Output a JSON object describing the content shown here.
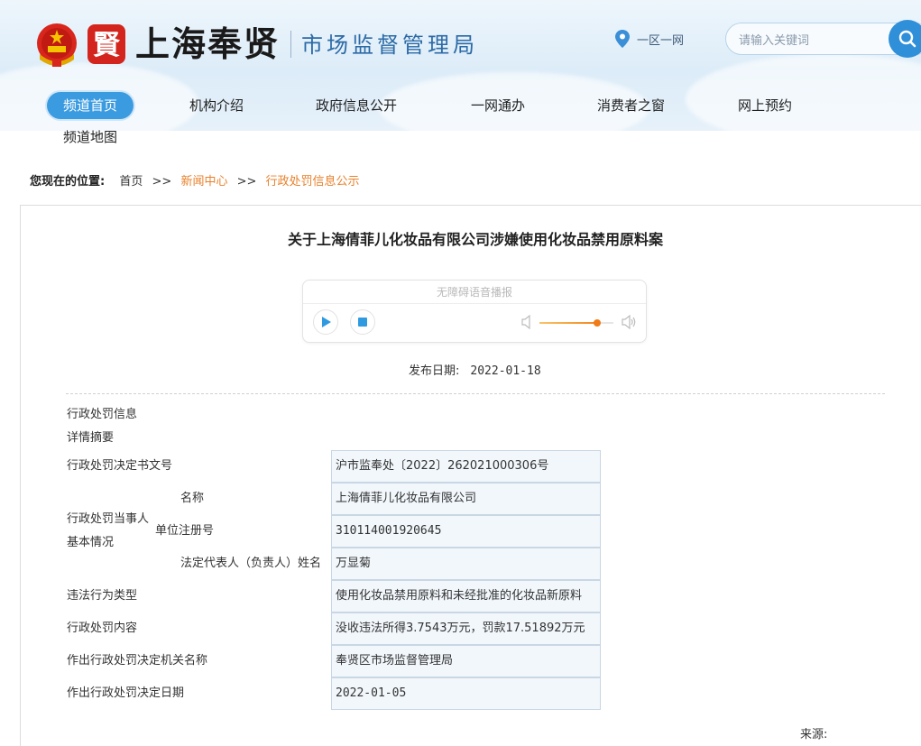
{
  "header": {
    "brand_name": "上海奉贤",
    "brand_sub": "市场监督管理局",
    "seal_text": "賢",
    "location_label": "一区一网",
    "search_placeholder": "请输入关键词"
  },
  "nav": {
    "items": [
      {
        "label": "频道首页",
        "active": true
      },
      {
        "label": "机构介绍"
      },
      {
        "label": "政府信息公开"
      },
      {
        "label": "一网通办"
      },
      {
        "label": "消费者之窗"
      },
      {
        "label": "网上预约"
      },
      {
        "label": "频道地图"
      }
    ]
  },
  "breadcrumb": {
    "lead": "您现在的位置:",
    "items": [
      "首页",
      "新闻中心",
      "行政处罚信息公示"
    ],
    "separator": ">>"
  },
  "article": {
    "title": "关于上海倩菲儿化妆品有限公司涉嫌使用化妆品禁用原料案",
    "player": {
      "label": "无障碍语音播报",
      "volume": 0.78
    },
    "publish_label": "发布日期:",
    "publish_date": "2022-01-18",
    "source_label": "来源:"
  },
  "info": {
    "section_heading": "行政处罚信息",
    "section_sub": "详情摘要",
    "rows": {
      "doc_no_label": "行政处罚决定书文号",
      "doc_no_value": "沪市监奉处〔2022〕262021000306号",
      "party_label_1": "行政处罚当事人",
      "party_label_2": "基本情况",
      "name_label": "名称",
      "name_value": "上海倩菲儿化妆品有限公司",
      "reg_label": "单位注册号",
      "reg_value": "310114001920645",
      "rep_label": "法定代表人（负责人）姓名",
      "rep_value": "万显菊",
      "violation_label": "违法行为类型",
      "violation_value": "使用化妆品禁用原料和未经批准的化妆品新原料",
      "content_label": "行政处罚内容",
      "content_value": "没收违法所得3.7543万元，罚款17.51892万元",
      "authority_label": "作出行政处罚决定机关名称",
      "authority_value": "奉贤区市场监督管理局",
      "date_label": "作出行政处罚决定日期",
      "date_value": "2022-01-05"
    }
  }
}
